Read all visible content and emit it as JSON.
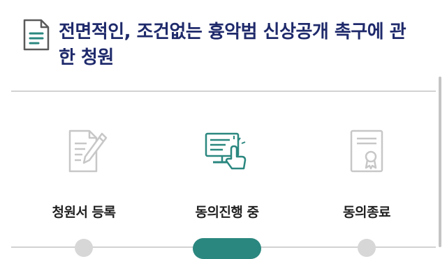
{
  "petition": {
    "title": "전면적인, 조건없는 흉악범 신상공개 촉구에 관한 청원"
  },
  "steps": [
    {
      "label": "청원서 등록",
      "icon": "document-pen-icon",
      "state": "done"
    },
    {
      "label": "동의진행 중",
      "icon": "monitor-hand-icon",
      "state": "current"
    },
    {
      "label": "동의종료",
      "icon": "certificate-icon",
      "state": "pending"
    }
  ],
  "colors": {
    "title": "#1f2a6b",
    "accent": "#2a877f",
    "inactive_icon": "#c7c7c7",
    "divider": "#d2d2d2"
  }
}
